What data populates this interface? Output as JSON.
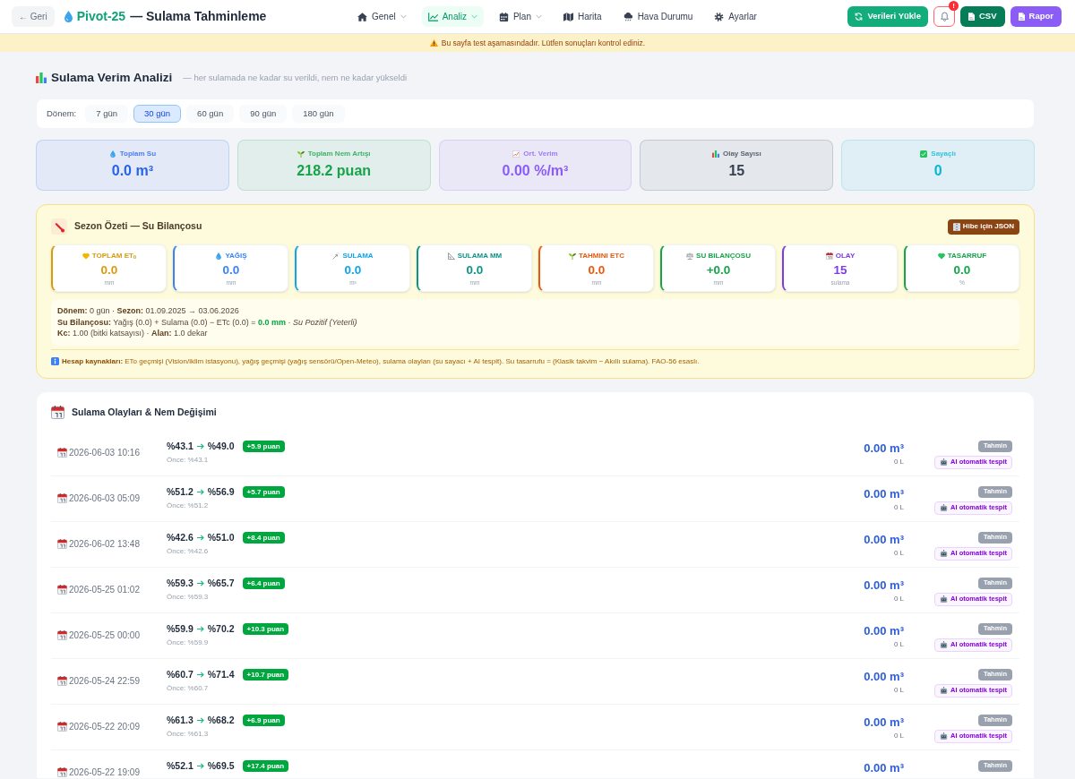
{
  "header": {
    "back_button": "← Geri",
    "project": "Pivot-25",
    "title": "— Sulama Tahminleme",
    "nav": [
      {
        "label": "Genel",
        "selected": false,
        "has_menu": true
      },
      {
        "label": "Analiz",
        "selected": true,
        "has_menu": true
      },
      {
        "label": "Plan",
        "selected": false,
        "has_menu": true
      },
      {
        "label": "Harita",
        "selected": false,
        "has_menu": false
      },
      {
        "label": "Hava Durumu",
        "selected": false,
        "has_menu": false
      },
      {
        "label": "Ayarlar",
        "selected": false,
        "has_menu": false
      }
    ],
    "actions": [
      {
        "kind": "load",
        "label": "Verileri Yükle"
      },
      {
        "kind": "notifications",
        "badge": "!"
      },
      {
        "kind": "csv",
        "label": "CSV"
      },
      {
        "kind": "report",
        "label": "Rapor"
      }
    ]
  },
  "warning_banner": "Bu sayfa test aşamasındadır. Lütfen sonuçları kontrol ediniz.",
  "page_heading": {
    "title": "Sulama Verim Analizi",
    "subtitle": "— her sulamada ne kadar su verildi, nem ne kadar yükseldi"
  },
  "period_filter": {
    "label": "Dönem:",
    "options": [
      {
        "label": "7 gün",
        "selected": false
      },
      {
        "label": "30 gün",
        "selected": true
      },
      {
        "label": "60 gün",
        "selected": false
      },
      {
        "label": "90 gün",
        "selected": false
      },
      {
        "label": "180 gün",
        "selected": false
      }
    ]
  },
  "stats": [
    {
      "label": "Toplam Su",
      "value": "0.0 m³",
      "color": "#2563eb"
    },
    {
      "label": "Toplam Nem Artışı",
      "value": "218.2 puan",
      "color": "#16a34a"
    },
    {
      "label": "Ort. Verim",
      "value": "0.00 %/m³",
      "color": "#8b5cf6"
    },
    {
      "label": "Olay Sayısı",
      "value": "15",
      "color": "#374151"
    },
    {
      "label": "Sayaçlı",
      "value": "0",
      "color": "#06b6d4"
    }
  ],
  "season_summary": {
    "title": "Sezon Özeti — Su Bilançosu",
    "export_button": "Hibe için JSON",
    "metrics": [
      {
        "label": "TOPLAM ET$_{0}$",
        "value": "0.0",
        "unit": "mm",
        "color": "#d99a0e"
      },
      {
        "label": "YAĞIŞ",
        "value": "0.0",
        "unit": "mm",
        "color": "#3b82f6"
      },
      {
        "label": "SULAMA",
        "value": "0.0",
        "unit": "m³",
        "color": "#0ea5e9"
      },
      {
        "label": "SULAMA MM",
        "value": "0.0",
        "unit": "mm",
        "color": "#0d9488"
      },
      {
        "label": "TAHMINI ETC",
        "value": "0.0",
        "unit": "mm",
        "color": "#ea580c"
      },
      {
        "label": "SU BILANÇOSU",
        "value": "+0.0",
        "unit": "mm",
        "color": "#16a34a"
      },
      {
        "label": "OLAY",
        "value": "15",
        "unit": "sulama",
        "color": "#7c3aed"
      },
      {
        "label": "TASARRUF",
        "value": "0.0",
        "unit": "%",
        "color": "#16a34a"
      }
    ],
    "period_line": "**Dönem:** 0 gün · **Sezon:** 01.09.2025 → 03.06.2026",
    "balance_line": {
      "formula": "**Su Bilançosu:** Yağış (0.0) + Sulama (0.0) − ETc (0.0) =",
      "result": "0.0 mm",
      "after": "· *Su Pozitif (Yeterli)*"
    },
    "crop_line": "**Kc:** 1.00 (bitki katsayısı) · **Alan:** 1.0 dekar",
    "sources": "**Hesap kaynakları:** ETo geçmişi (Vision/iklim istasyonu), yağış geçmişi (yağış sensörü/Open-Meteo), sulama olayları (su sayacı + AI tespit). Su tasarrufu = (Klasik takvim − Akıllı sulama). FAO-56 esaslı."
  },
  "events": {
    "title": "Sulama Olayları & Nem Değişimi",
    "rows": [
      {
        "datetime": "2026-06-03 10:16",
        "before": "%43.1",
        "after": "%49.0",
        "change": "+5.9 puan",
        "previous": "Önce: %43.1",
        "volume": "0.00 m³",
        "liters": "0 L",
        "method": "Tahmin",
        "source": "AI otomatik tespit"
      },
      {
        "datetime": "2026-06-03 05:09",
        "before": "%51.2",
        "after": "%56.9",
        "change": "+5.7 puan",
        "previous": "Önce: %51.2",
        "volume": "0.00 m³",
        "liters": "0 L",
        "method": "Tahmin",
        "source": "AI otomatik tespit"
      },
      {
        "datetime": "2026-06-02 13:48",
        "before": "%42.6",
        "after": "%51.0",
        "change": "+8.4 puan",
        "previous": "Önce: %42.6",
        "volume": "0.00 m³",
        "liters": "0 L",
        "method": "Tahmin",
        "source": "AI otomatik tespit"
      },
      {
        "datetime": "2026-05-25 01:02",
        "before": "%59.3",
        "after": "%65.7",
        "change": "+6.4 puan",
        "previous": "Önce: %59.3",
        "volume": "0.00 m³",
        "liters": "0 L",
        "method": "Tahmin",
        "source": "AI otomatik tespit"
      },
      {
        "datetime": "2026-05-25 00:00",
        "before": "%59.9",
        "after": "%70.2",
        "change": "+10.3 puan",
        "previous": "Önce: %59.9",
        "volume": "0.00 m³",
        "liters": "0 L",
        "method": "Tahmin",
        "source": "AI otomatik tespit"
      },
      {
        "datetime": "2026-05-24 22:59",
        "before": "%60.7",
        "after": "%71.4",
        "change": "+10.7 puan",
        "previous": "Önce: %60.7",
        "volume": "0.00 m³",
        "liters": "0 L",
        "method": "Tahmin",
        "source": "AI otomatik tespit"
      },
      {
        "datetime": "2026-05-22 20:09",
        "before": "%61.3",
        "after": "%68.2",
        "change": "+6.9 puan",
        "previous": "Önce: %61.3",
        "volume": "0.00 m³",
        "liters": "0 L",
        "method": "Tahmin",
        "source": "AI otomatik tespit"
      },
      {
        "datetime": "2026-05-22 19:09",
        "before": "%52.1",
        "after": "%69.5",
        "change": "+17.4 puan",
        "volume": "0.00 m³",
        "method": "Tahmin"
      }
    ]
  }
}
